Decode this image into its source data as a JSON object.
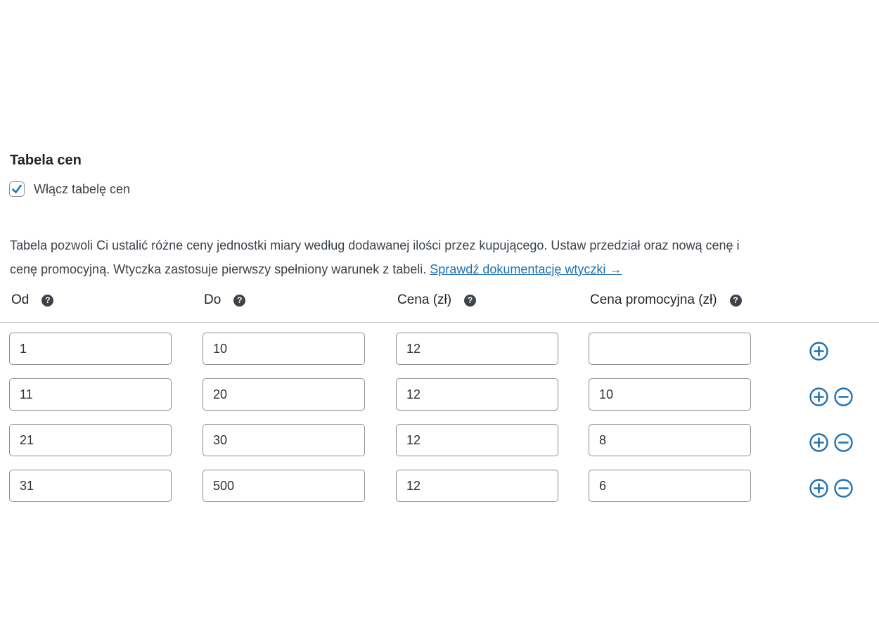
{
  "section": {
    "title": "Tabela cen"
  },
  "enable": {
    "label": "Włącz tabelę cen",
    "checked": true
  },
  "description": {
    "line1": "Tabela pozwoli Ci ustalić różne ceny jednostki miary według dodawanej ilości przez kupującego. Ustaw przedział oraz nową cenę i",
    "line2": "cenę promocyjną. Wtyczka zastosuje pierwszy spełniony warunek z tabeli.",
    "link_text": "Sprawdź dokumentację wtyczki →"
  },
  "columns": {
    "from": "Od",
    "to": "Do",
    "price": "Cena (zł)",
    "sale_price": "Cena promocyjna (zł)"
  },
  "rows": [
    {
      "from": "1",
      "to": "10",
      "price": "12",
      "sale_price": ""
    },
    {
      "from": "11",
      "to": "20",
      "price": "12",
      "sale_price": "10"
    },
    {
      "from": "21",
      "to": "30",
      "price": "12",
      "sale_price": "8"
    },
    {
      "from": "31",
      "to": "500",
      "price": "12",
      "sale_price": "6"
    }
  ],
  "icons": {
    "help": "question-circle-icon",
    "add": "plus-circle-icon",
    "remove": "minus-circle-icon",
    "check": "checkmark-icon"
  },
  "colors": {
    "accent": "#2271b1",
    "text": "#3c434a",
    "heading": "#1d2327",
    "border": "#8c8f94"
  }
}
